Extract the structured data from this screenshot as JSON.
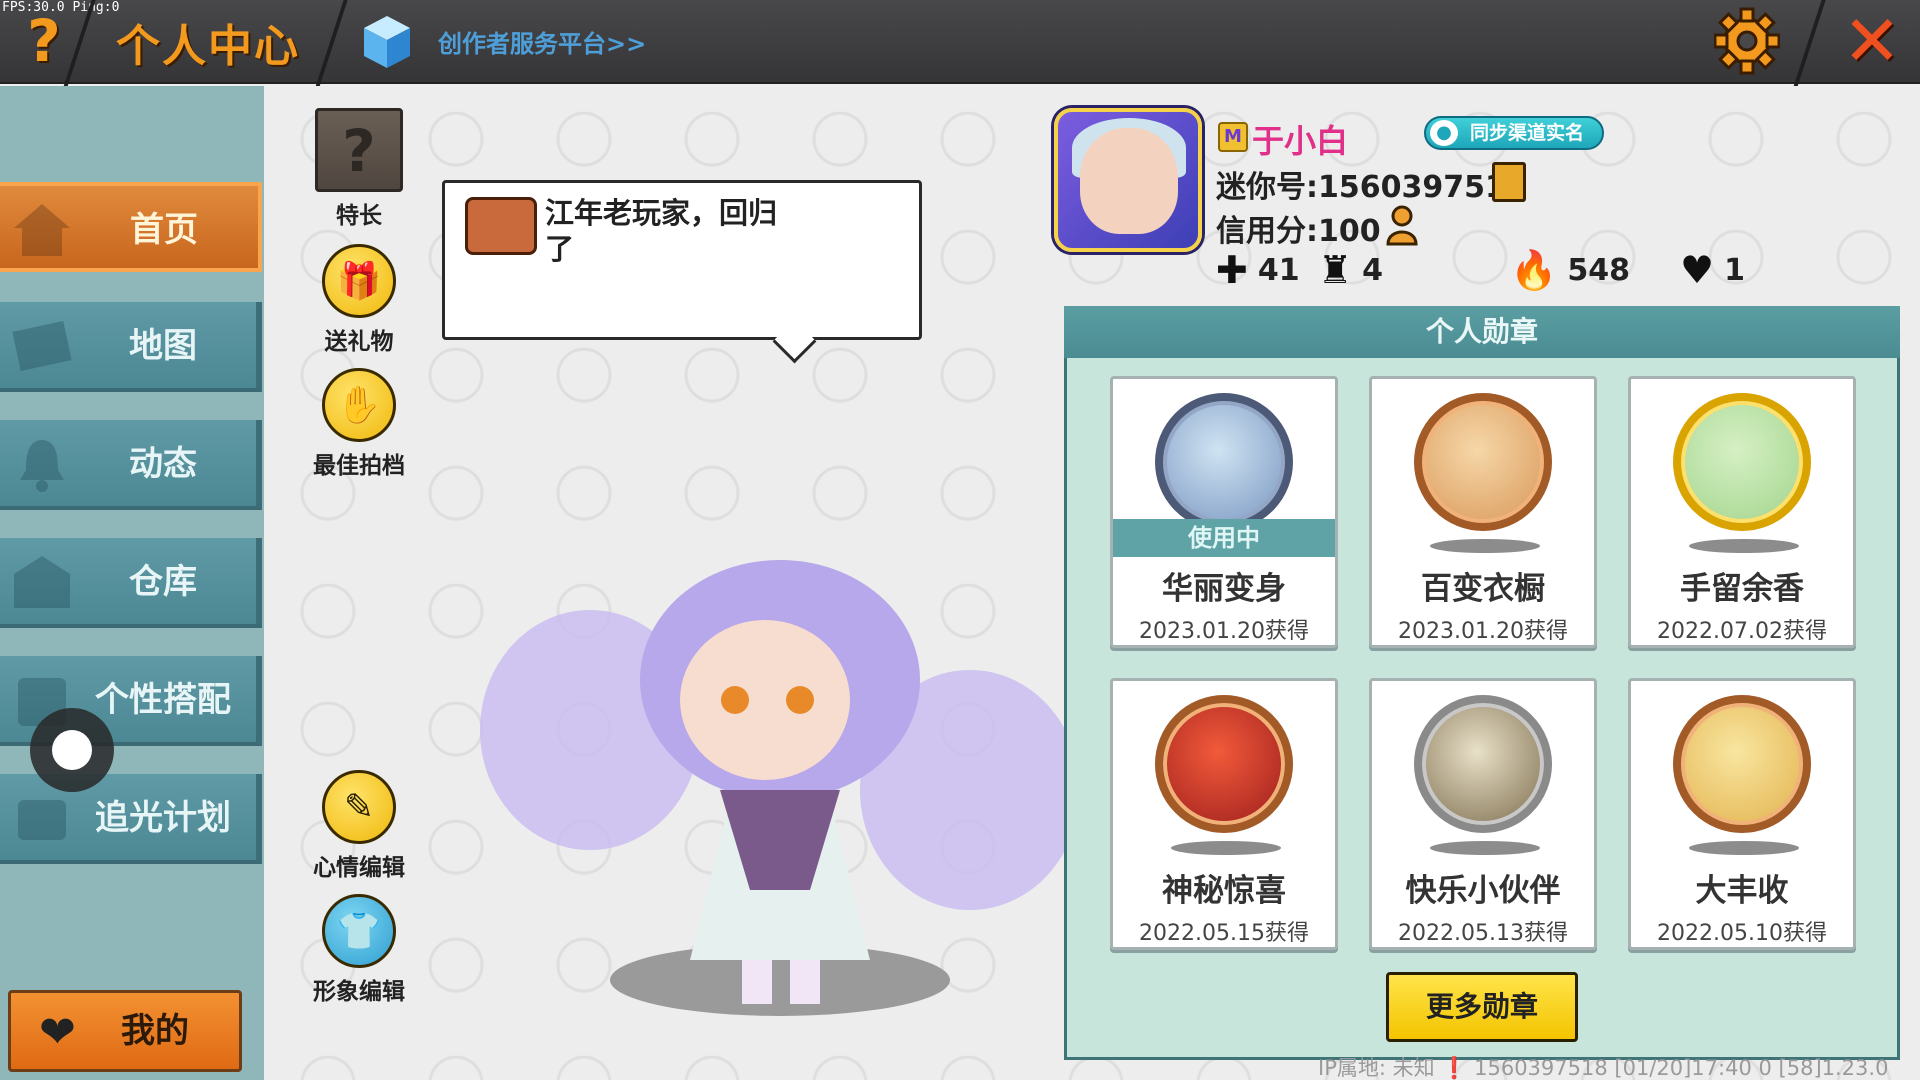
{
  "debug": {
    "fps_text": "FPS:30.0  Ping:0"
  },
  "header": {
    "title": "个人中心",
    "help_icon": "question-mark-icon",
    "creator_link": "创作者服务平台>>",
    "settings_icon": "gear-icon",
    "close_icon": "close-icon",
    "accent_color": "#f39a1e"
  },
  "sidebar": {
    "items": [
      {
        "label": "首页",
        "icon": "house-icon",
        "active": true
      },
      {
        "label": "地图",
        "icon": "map-icon",
        "active": false
      },
      {
        "label": "动态",
        "icon": "bell-icon",
        "active": false
      },
      {
        "label": "仓库",
        "icon": "warehouse-icon",
        "active": false
      },
      {
        "label": "个性搭配",
        "icon": "wardrobe-icon",
        "active": false
      },
      {
        "label": "追光计划",
        "icon": "plan-icon",
        "active": false
      }
    ],
    "mine_button": {
      "label": "我的",
      "icon": "heart-icon"
    }
  },
  "actions": {
    "skill": "特长",
    "gift": "送礼物",
    "partner": "最佳拍档",
    "mood_edit": "心情编辑",
    "image_edit": "形象编辑"
  },
  "bubble": {
    "text": "江年老玩家，回归了"
  },
  "profile": {
    "username": "于小白",
    "sync_badge": "同步渠道实名",
    "mini_id": "迷你号:1560397518",
    "credit": "信用分:100",
    "stats": [
      {
        "icon": "add-friend-icon",
        "value": "41"
      },
      {
        "icon": "fans-icon",
        "value": "4"
      },
      {
        "icon": "flame-icon",
        "value": "548"
      },
      {
        "icon": "heart-icon",
        "value": "1"
      }
    ]
  },
  "medals": {
    "title": "个人勋章",
    "in_use_label": "使用中",
    "items": [
      {
        "name": "华丽变身",
        "date": "2023.01.20获得",
        "in_use": true
      },
      {
        "name": "百变衣橱",
        "date": "2023.01.20获得",
        "in_use": false
      },
      {
        "name": "手留余香",
        "date": "2022.07.02获得",
        "in_use": false
      },
      {
        "name": "神秘惊喜",
        "date": "2022.05.15获得",
        "in_use": false
      },
      {
        "name": "快乐小伙伴",
        "date": "2022.05.13获得",
        "in_use": false
      },
      {
        "name": "大丰收",
        "date": "2022.05.10获得",
        "in_use": false
      }
    ],
    "more_button": "更多勋章"
  },
  "footer": {
    "text": "IP属地: 未知 ❗   1560397518   [01/20]17:40 0   [58]1.23.0"
  }
}
